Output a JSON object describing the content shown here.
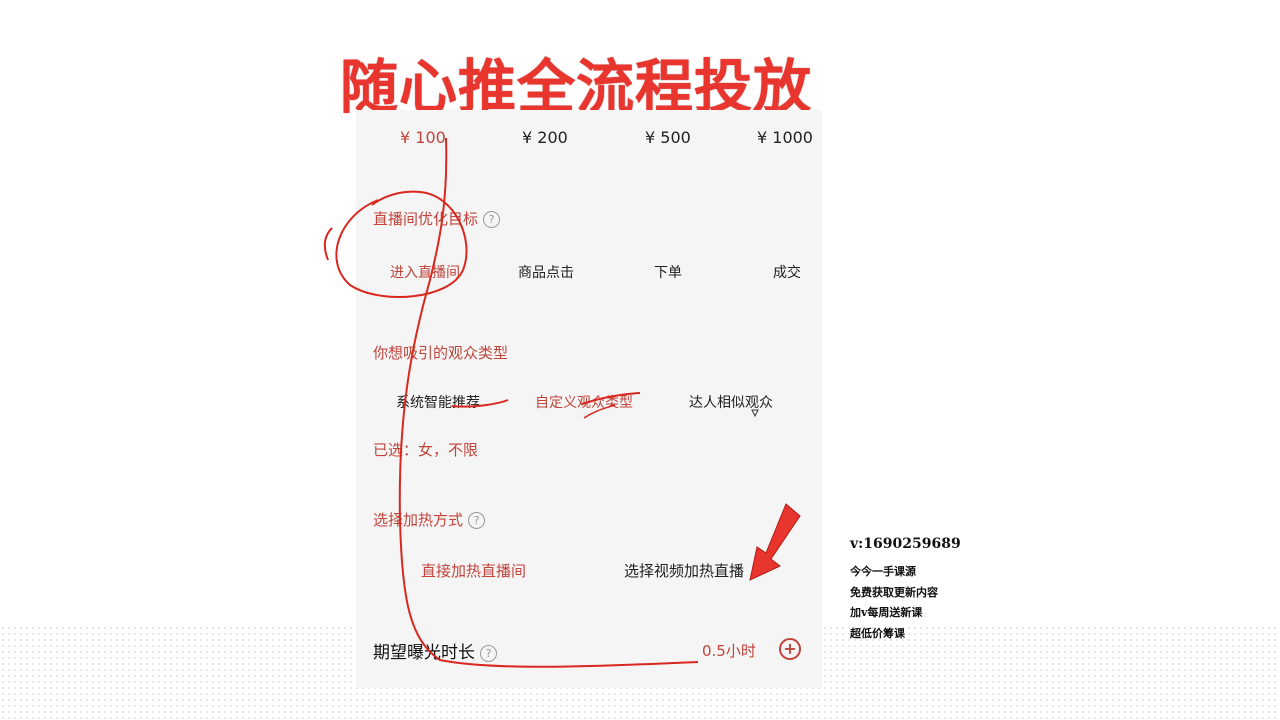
{
  "title": "随心推全流程投放",
  "amounts": [
    "¥ 100",
    "¥ 200",
    "¥ 500",
    "¥ 1000"
  ],
  "optimization": {
    "label": "直播间优化目标",
    "options": [
      "进入直播间",
      "商品点击",
      "下单",
      "成交"
    ]
  },
  "audience": {
    "label": "你想吸引的观众类型",
    "options": [
      "系统智能推荐",
      "自定义观众类型",
      "达人相似观众"
    ],
    "selected": "已选：女，不限"
  },
  "heat": {
    "label": "选择加热方式",
    "options": [
      "直接加热直播间",
      "选择视频加热直播"
    ]
  },
  "exposure": {
    "label": "期望曝光时长",
    "value": "0.5小时",
    "plus_symbol": "+"
  },
  "help_symbol": "?",
  "side_notes": {
    "contact": "v:1690259689",
    "lines": [
      "今今一手课源",
      "免费获取更新内容",
      "加v每周送新课",
      "超低价筹课"
    ]
  },
  "colors": {
    "accent": "#c0443b",
    "annotation": "#e8352e",
    "panel": "#f5f5f5"
  }
}
